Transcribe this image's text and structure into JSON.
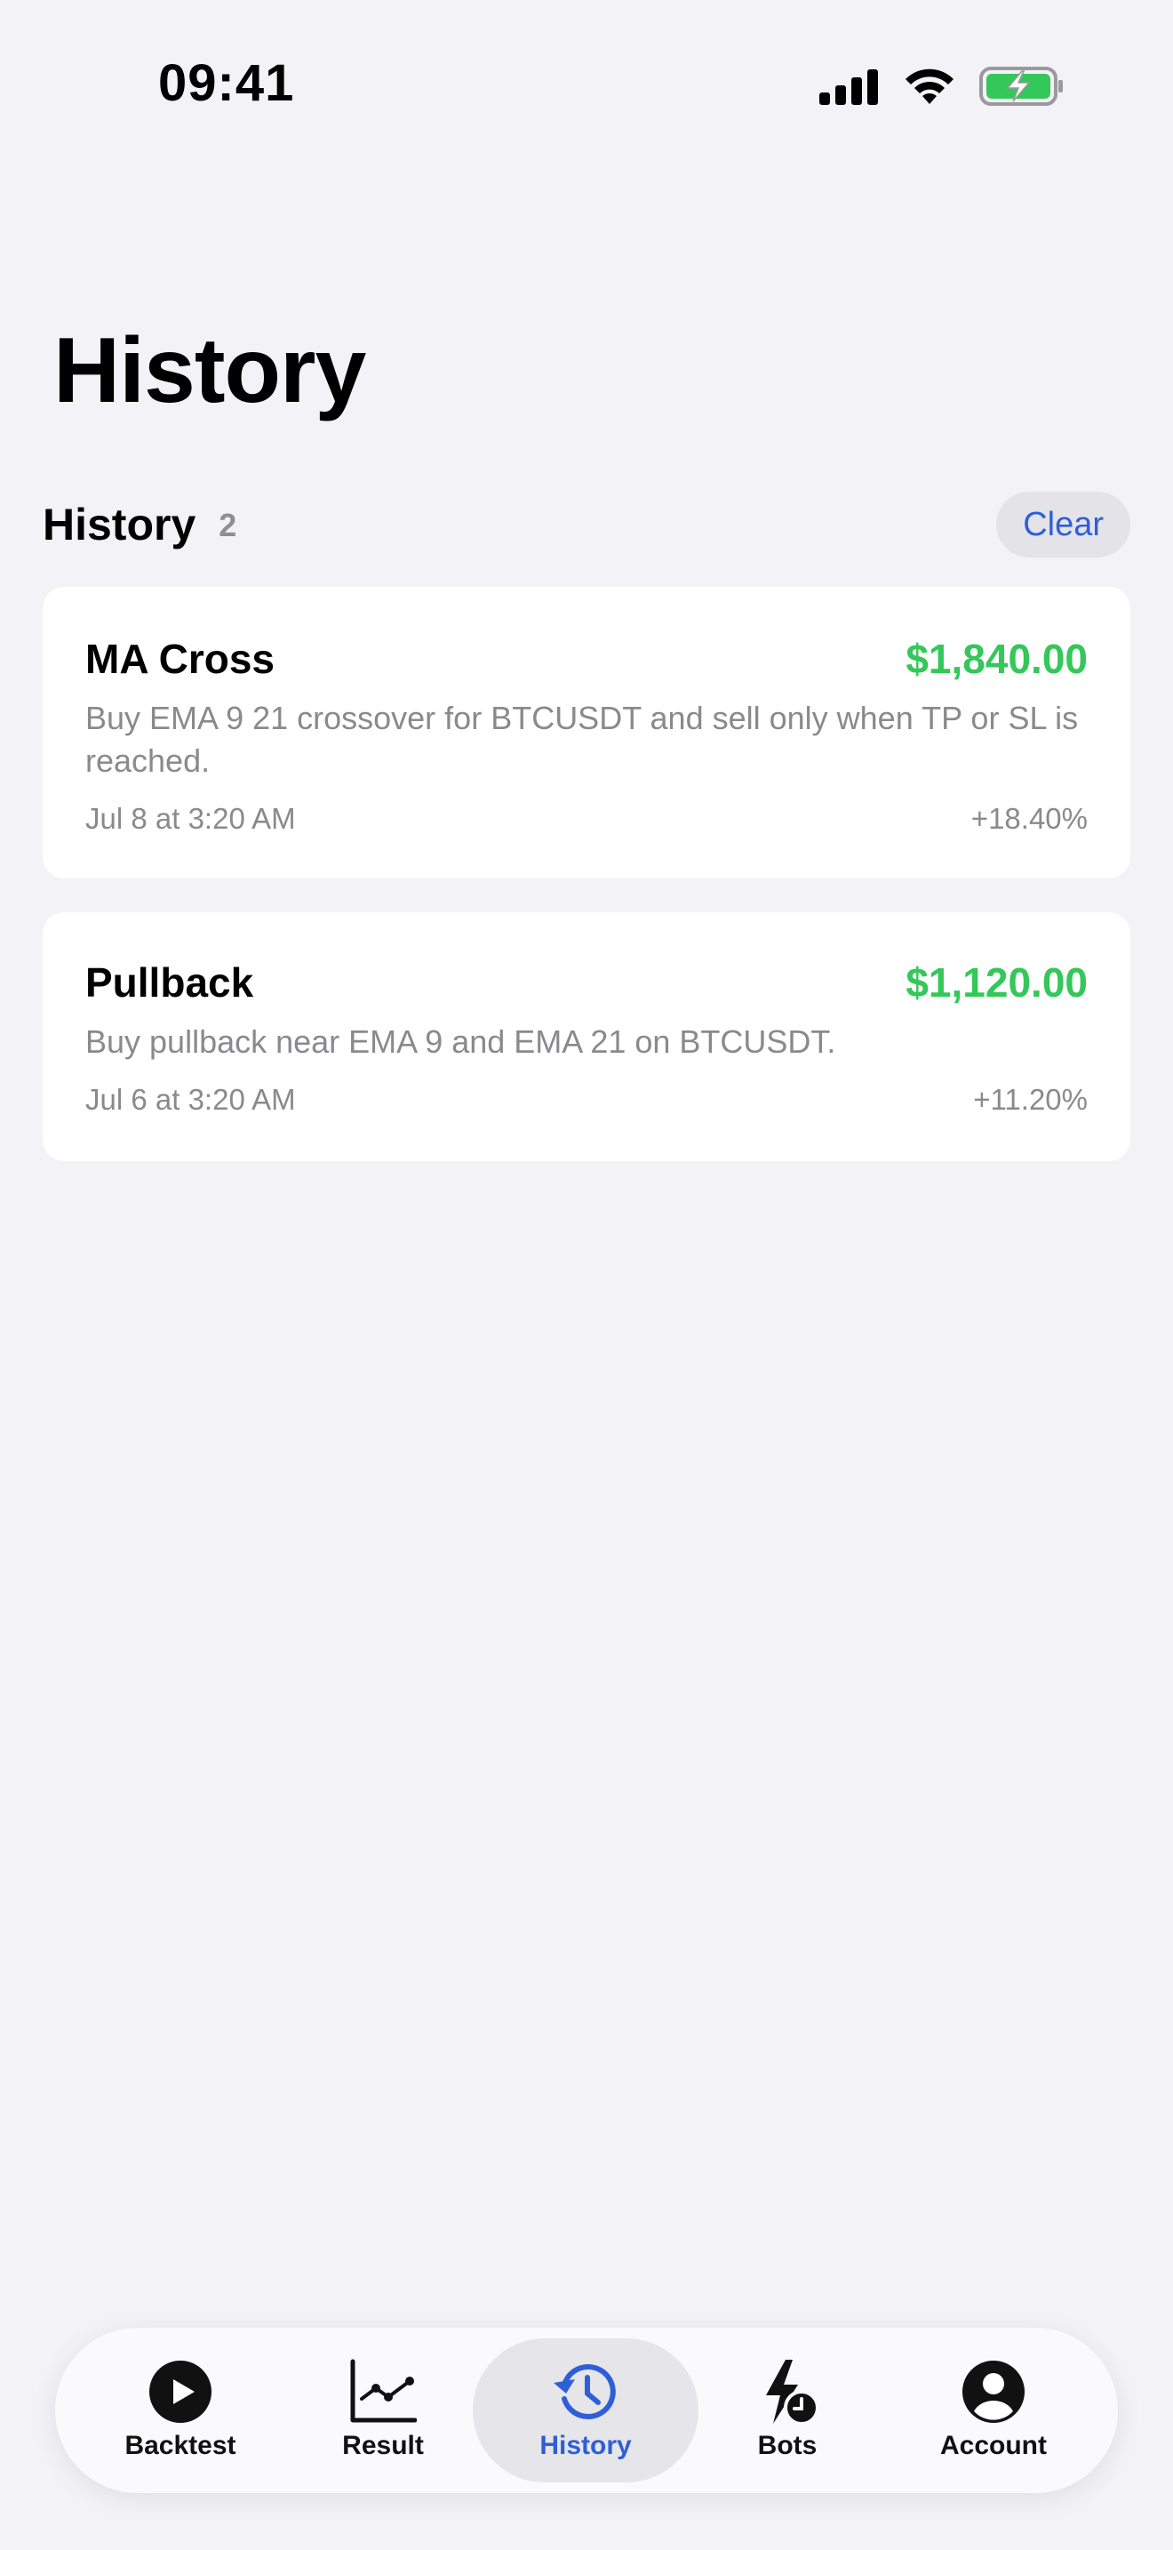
{
  "status_bar": {
    "time": "09:41"
  },
  "page": {
    "title": "History"
  },
  "section": {
    "title": "History",
    "count": "2",
    "clear_label": "Clear"
  },
  "history_items": [
    {
      "name": "MA Cross",
      "amount": "$1,840.00",
      "description": "Buy EMA 9 21 crossover for BTCUSDT and sell only when TP or SL is reached.",
      "date": "Jul 8 at 3:20 AM",
      "change": "+18.40%"
    },
    {
      "name": "Pullback",
      "amount": "$1,120.00",
      "description": "Buy pullback near EMA 9 and EMA 21 on BTCUSDT.",
      "date": "Jul 6 at 3:20 AM",
      "change": "+11.20%"
    }
  ],
  "tab_bar": {
    "tabs": [
      {
        "label": "Backtest",
        "icon": "play-circle-icon",
        "active": false
      },
      {
        "label": "Result",
        "icon": "line-chart-icon",
        "active": false
      },
      {
        "label": "History",
        "icon": "clock-history-icon",
        "active": true
      },
      {
        "label": "Bots",
        "icon": "bolt-clock-icon",
        "active": false
      },
      {
        "label": "Account",
        "icon": "person-circle-icon",
        "active": false
      }
    ]
  },
  "colors": {
    "background": "#f2f2f7",
    "accent": "#2f5fd6",
    "positive": "#34c759",
    "secondary_text": "#8a8a8e",
    "battery": "#34c759"
  }
}
